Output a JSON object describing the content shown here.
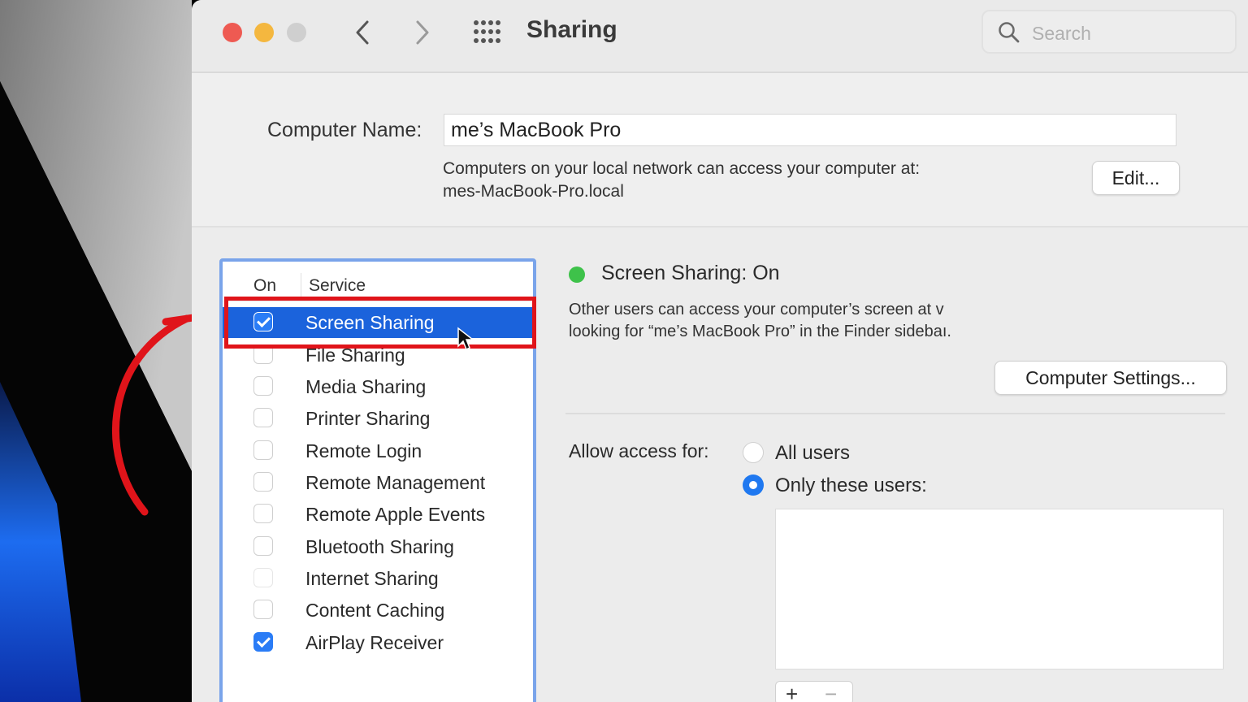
{
  "window": {
    "title": "Sharing",
    "search_placeholder": "Search"
  },
  "computer_name": {
    "label": "Computer Name:",
    "value": "me’s MacBook Pro",
    "description_line1": "Computers on your local network can access your computer at:",
    "description_line2": "mes-MacBook-Pro.local",
    "edit_label": "Edit..."
  },
  "services": {
    "header_on": "On",
    "header_service": "Service",
    "items": [
      {
        "label": "Screen Sharing",
        "checked": true,
        "selected": true
      },
      {
        "label": "File Sharing",
        "checked": false
      },
      {
        "label": "Media Sharing",
        "checked": false
      },
      {
        "label": "Printer Sharing",
        "checked": false
      },
      {
        "label": "Remote Login",
        "checked": false
      },
      {
        "label": "Remote Management",
        "checked": false
      },
      {
        "label": "Remote Apple Events",
        "checked": false
      },
      {
        "label": "Bluetooth Sharing",
        "checked": false
      },
      {
        "label": "Internet Sharing",
        "checked": false
      },
      {
        "label": "Content Caching",
        "checked": false
      },
      {
        "label": "AirPlay Receiver",
        "checked": true
      }
    ]
  },
  "detail": {
    "status": "Screen Sharing: On",
    "status_color": "#3ec24a",
    "desc_line1": "Other users can access your computer’s screen at v",
    "desc_line2": "looking for “me’s MacBook Pro” in the Finder sidebaı.",
    "computer_settings_label": "Computer Settings...",
    "allow_access_label": "Allow access for:",
    "option_all_users": "All users",
    "option_only_these": "Only these users:",
    "selected_option": "Only these users:",
    "add_symbol": "+",
    "remove_symbol": "−"
  },
  "colors": {
    "selection": "#1b63dc",
    "highlight_annotation": "#e0141a",
    "checkbox_checked": "#2a7cf6"
  }
}
